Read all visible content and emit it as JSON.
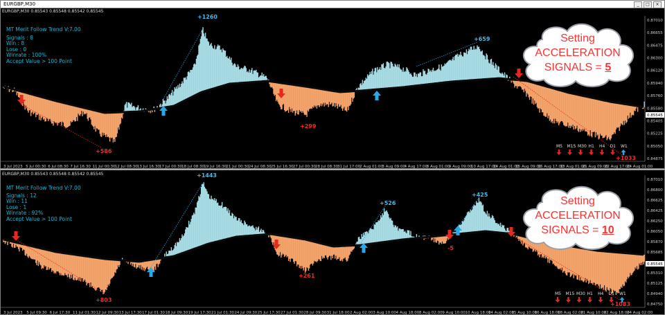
{
  "panes": [
    {
      "symbol": "EURGBP,M30",
      "quote": "EURGBP,M30  0.85543 0.85548 0.85542 0.85545",
      "indicator": {
        "name": "MT Merit Follow Trend",
        "version": "V:7.00",
        "signals": "Signals : 8",
        "win": "Win : 8",
        "lose": "Lose : 0",
        "winrate": "Winrate : 100%",
        "accept": "Accept Value > 100 Point"
      },
      "setting": {
        "line1": "Setting",
        "line2": "ACCELERATION",
        "line3": "SIGNALS = ",
        "value": "5"
      },
      "price_tag": "0.85545",
      "y_ticks": [
        "0.87010",
        "0.86655",
        "0.86475",
        "0.86300",
        "0.86120",
        "0.85940",
        "0.85760",
        "0.85580",
        "0.85405",
        "0.85225",
        "0.85050",
        "0.84875"
      ],
      "x_ticks": [
        "3 Jul 2023",
        "5 Jul 00:30",
        "6 Jul 08:30",
        "7 Jul 16:30",
        "11 Jul 00:30",
        "12 Jul 08:30",
        "13 Jul 16:30",
        "17 Jul 00:30",
        "18 Jul 08:30",
        "19 Jul 16:30",
        "21 Jul 00:30",
        "24 Jul 08:30",
        "25 Jul 16:30",
        "27 Jul 00:30",
        "28 Jul 08:30",
        "31 Jul 17:00",
        "2 Aug 01:00",
        "3 Aug 09:00",
        "4 Aug 17:00",
        "8 Aug 01:00",
        "9 Aug 09:00",
        "10 Aug 17:00",
        "14 Aug 01:00",
        "15 Aug 09:00",
        "16 Aug 17:00",
        "18 Aug 01:00",
        "21 Aug 09:00",
        "22 Aug 17:00",
        "24 Aug 01:00"
      ],
      "profits": [
        "+586",
        "+1260",
        "+299",
        "+659",
        "+1033"
      ],
      "timeframes": [
        "M5",
        "M15",
        "M30",
        "H1",
        "H4",
        "D1",
        "W1"
      ]
    },
    {
      "symbol": "EURGBP,M30",
      "quote": "EURGBP,M30  0.85543 0.85548 0.85542 0.85545",
      "indicator": {
        "name": "MT Merit Follow Trend",
        "version": "V:7.00",
        "signals": "Signals : 12",
        "win": "Win : 11",
        "lose": "Lose : 1",
        "winrate": "Winrate : 92%",
        "accept": "Accept Value > 100 Point"
      },
      "setting": {
        "line1": "Setting",
        "line2": "ACCELERATION",
        "line3": "SIGNALS = ",
        "value": "10"
      },
      "price_tag": "0.85545",
      "y_ticks": [
        "0.87010",
        "0.86800",
        "0.86625",
        "0.86425",
        "0.86250",
        "0.86050",
        "0.85870",
        "0.85685",
        "0.85500",
        "0.85310",
        "0.85125",
        "0.84940",
        "0.84750"
      ],
      "x_ticks": [
        "3 Jul 2023",
        "5 Jul 09:30",
        "6 Jul 17:30",
        "11 Jul 01:30",
        "12 Jul 09:30",
        "13 Jul 17:30",
        "17 Jul 01:30",
        "18 Jul 09:30",
        "19 Jul 17:30",
        "21 Jul 01:30",
        "24 Jul 09:30",
        "25 Jul 17:30",
        "27 Jul 01:30",
        "28 Jul 09:30",
        "31 Jul 18:00",
        "2 Aug 02:00",
        "3 Aug 10:00",
        "4 Aug 18:00",
        "8 Aug 02:00",
        "9 Aug 10:00",
        "10 Aug 18:00",
        "14 Aug 02:00",
        "15 Aug 10:00",
        "16 Aug 18:00",
        "18 Aug 02:00",
        "21 Aug 10:00",
        "22 Aug 18:00",
        "24 Aug 02:00"
      ],
      "profits": [
        "+803",
        "+1443",
        "+261",
        "+526",
        "-5",
        "+425",
        "+1083"
      ],
      "timeframes": [
        "M5",
        "M15",
        "M30",
        "H1",
        "H4",
        "D1",
        "W1"
      ]
    }
  ],
  "colors": {
    "bull_fill": "#a8dce5",
    "bear_fill": "#f4a46a",
    "trend_line": "#0a0a0a",
    "buy_arrow": "#29a8e8",
    "sell_arrow": "#e8281e",
    "bull_label": "#48b8e8",
    "bear_label": "#e83030",
    "indicator_text": "#17b7d6",
    "cloud_text": "#ff3030"
  }
}
